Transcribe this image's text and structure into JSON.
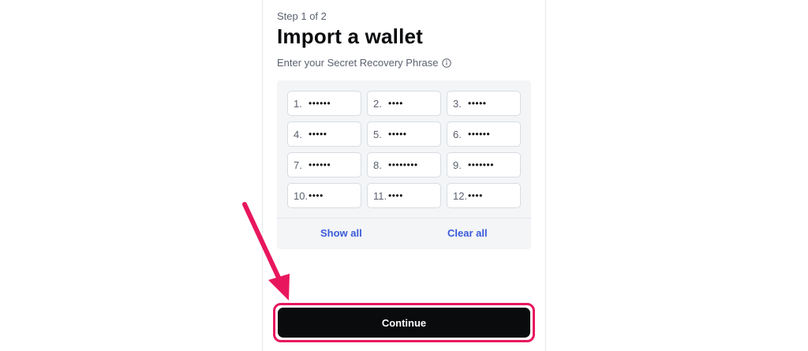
{
  "header": {
    "step": "Step 1 of 2",
    "title": "Import a wallet",
    "subtitle": "Enter your Secret Recovery Phrase"
  },
  "phrase": {
    "words": [
      {
        "num": "1.",
        "mask": "••••••"
      },
      {
        "num": "2.",
        "mask": "••••"
      },
      {
        "num": "3.",
        "mask": "•••••"
      },
      {
        "num": "4.",
        "mask": "•••••"
      },
      {
        "num": "5.",
        "mask": "•••••"
      },
      {
        "num": "6.",
        "mask": "••••••"
      },
      {
        "num": "7.",
        "mask": "••••••"
      },
      {
        "num": "8.",
        "mask": "••••••••"
      },
      {
        "num": "9.",
        "mask": "•••••••"
      },
      {
        "num": "10.",
        "mask": "••••"
      },
      {
        "num": "11.",
        "mask": "••••"
      },
      {
        "num": "12.",
        "mask": "••••"
      }
    ],
    "show_all": "Show all",
    "clear_all": "Clear all"
  },
  "actions": {
    "continue_label": "Continue"
  },
  "colors": {
    "accent": "#3a5bd9",
    "primary_button": "#0a0b0d",
    "annotation": "#e8175d"
  },
  "icons": {
    "info": "info-circle-icon",
    "pointer": "annotation-arrow-icon"
  }
}
